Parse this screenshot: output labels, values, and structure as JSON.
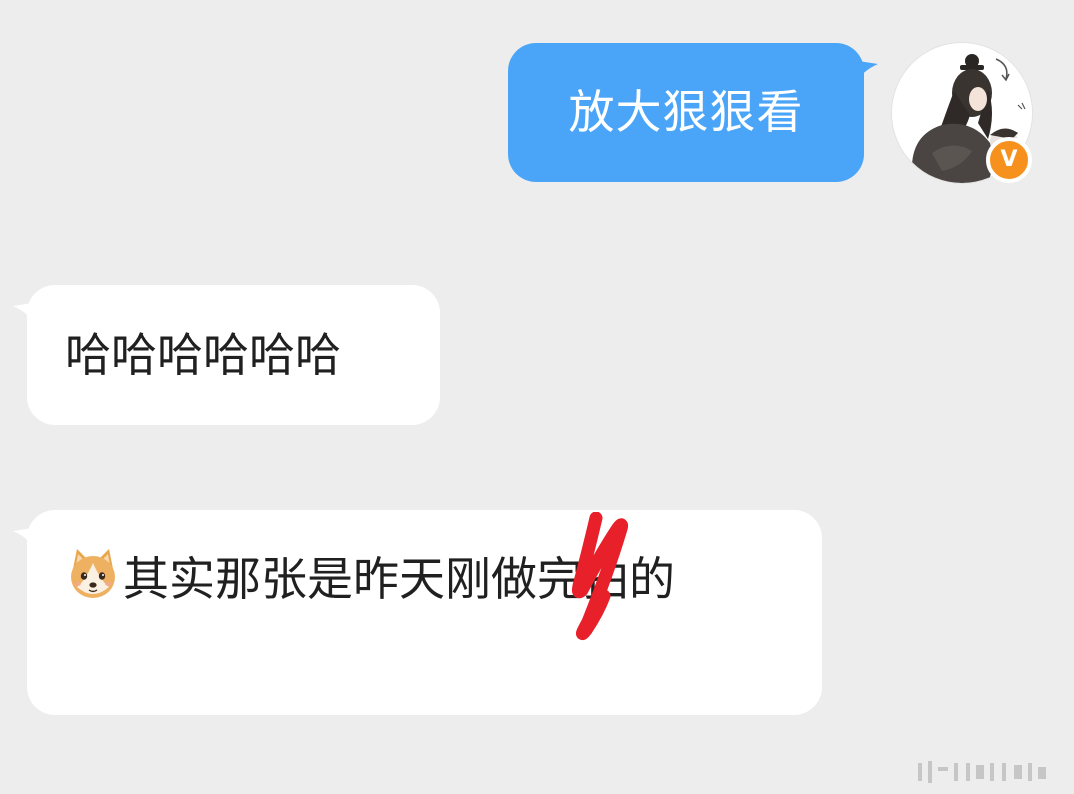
{
  "messages": {
    "outgoing": {
      "text": "放大狠狠看",
      "bubble_color": "#4aa5f8"
    },
    "incoming": [
      {
        "text": "哈哈哈哈哈哈"
      },
      {
        "emoji": "doge-emoji",
        "text": "其实那张是昨天刚做完拍的"
      }
    ]
  },
  "avatar": {
    "badge_text": "V",
    "badge_color": "#f6911e"
  },
  "annotation": {
    "mark_color": "#e8202a"
  },
  "theme": {
    "background": "#ededed",
    "incoming_bubble": "#ffffff",
    "text_color": "#202020"
  }
}
